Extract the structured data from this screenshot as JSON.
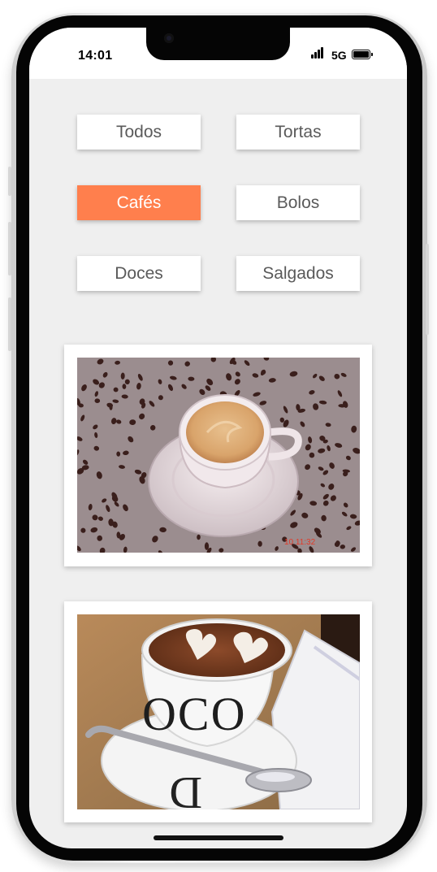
{
  "status_bar": {
    "time": "14:01",
    "network": "5G"
  },
  "categories": [
    {
      "label": "Todos",
      "active": false
    },
    {
      "label": "Tortas",
      "active": false
    },
    {
      "label": "Cafés",
      "active": true
    },
    {
      "label": "Bolos",
      "active": false
    },
    {
      "label": "Doces",
      "active": false
    },
    {
      "label": "Salgados",
      "active": false
    }
  ],
  "photos": [
    {
      "name": "coffee-beans-espresso-photo",
      "timestamp": "10 11:32"
    },
    {
      "name": "cappuccino-heart-latte-art-photo",
      "cup_lettering": "OCO"
    }
  ],
  "colors": {
    "accent": "#ff7f4d",
    "background": "#efefef"
  }
}
